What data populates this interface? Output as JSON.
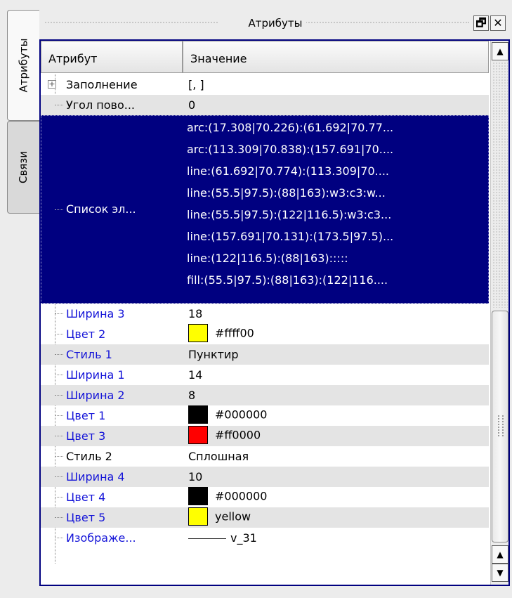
{
  "side_tabs": [
    "Атрибуты",
    "Связи"
  ],
  "dock": {
    "title": "Атрибуты",
    "float_glyph": "🗗",
    "close_glyph": "✕"
  },
  "table": {
    "columns": [
      "Атрибут",
      "Значение"
    ],
    "rows": [
      {
        "name": "Заполнение",
        "value": "[, ]",
        "expandable": true,
        "name_color": "black"
      },
      {
        "name": "Угол пово...",
        "value": "0",
        "name_color": "black"
      },
      {
        "name": "Список эл...",
        "name_color": "black",
        "selected": true,
        "values": [
          "arc:(17.308|70.226):(61.692|70.77...",
          "arc:(113.309|70.838):(157.691|70....",
          "line:(61.692|70.774):(113.309|70....",
          "line:(55.5|97.5):(88|163):w3:c3:w...",
          "line:(55.5|97.5):(122|116.5):w3:c3...",
          "line:(157.691|70.131):(173.5|97.5)...",
          "line:(122|116.5):(88|163):::::",
          "fill:(55.5|97.5):(88|163):(122|116...."
        ]
      },
      {
        "name": "Ширина 3",
        "value": "18",
        "name_color": "blue"
      },
      {
        "name": "Цвет 2",
        "value": "#ffff00",
        "swatch": "#ffff00",
        "name_color": "blue"
      },
      {
        "name": "Стиль 1",
        "value": "Пунктир",
        "name_color": "blue"
      },
      {
        "name": "Ширина 1",
        "value": "14",
        "name_color": "blue"
      },
      {
        "name": "Ширина 2",
        "value": "8",
        "name_color": "blue"
      },
      {
        "name": "Цвет 1",
        "value": "#000000",
        "swatch": "#000000",
        "name_color": "blue"
      },
      {
        "name": "Цвет 3",
        "value": "#ff0000",
        "swatch": "#ff0000",
        "name_color": "blue"
      },
      {
        "name": "Стиль 2",
        "value": "Сплошная",
        "name_color": "black"
      },
      {
        "name": "Ширина 4",
        "value": "10",
        "name_color": "blue"
      },
      {
        "name": "Цвет 4",
        "value": "#000000",
        "swatch": "#000000",
        "name_color": "blue"
      },
      {
        "name": "Цвет 5",
        "value": "yellow",
        "swatch": "#ffff00",
        "name_color": "blue"
      },
      {
        "name": "Изображе...",
        "value": "v_31",
        "line_preview": true,
        "name_color": "blue"
      }
    ]
  },
  "colors": {
    "selection": "#000080",
    "blue_text": "#1414d8",
    "border": "#000080"
  }
}
